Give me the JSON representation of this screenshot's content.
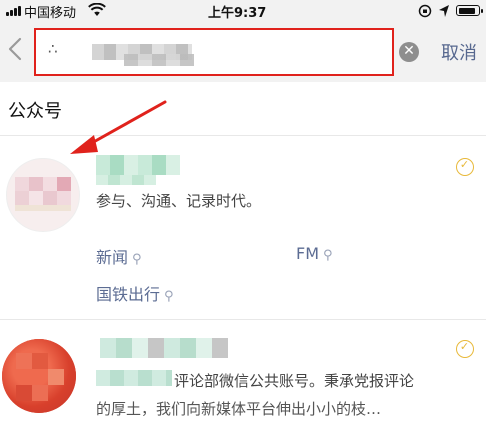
{
  "status_bar": {
    "carrier": "中国移动",
    "time": "上午9:37"
  },
  "search": {
    "query_prefix": "∴",
    "cancel_label": "取消"
  },
  "section": {
    "title": "公众号"
  },
  "results": [
    {
      "description": "参与、沟通、记录时代。",
      "tags": [
        {
          "label": "新闻"
        },
        {
          "label": "FM"
        },
        {
          "label": "国铁出行"
        }
      ]
    },
    {
      "description_line1": "评论部微信公共账号。秉承党报评论",
      "description_line2": "的厚土，我们向新媒体平台伸出小小的",
      "description_line2_suffix": "枝…"
    }
  ],
  "colors": {
    "highlight_box": "#e0221c",
    "link_blue": "#57688f",
    "verified_gold": "#e8b93a"
  },
  "icons": {
    "back": "chevron-left-icon",
    "clear": "clear-circle-icon",
    "verified": "verified-check-icon",
    "link": "link-icon"
  }
}
